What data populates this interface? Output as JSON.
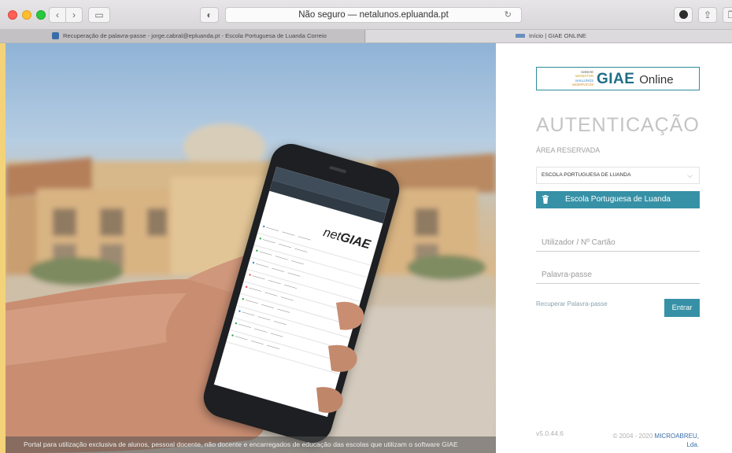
{
  "browser": {
    "address": "Não seguro — netalunos.epluanda.pt",
    "tabs": [
      {
        "label": "Recuperação de palavra-passe - jorge.cabral@epluanda.pt - Escola Portuguesa de Luanda Correio"
      },
      {
        "label": "Início | GIAE ONLINE"
      }
    ]
  },
  "hero": {
    "caption": "Portal para utilização exclusiva de alunos, pessoal docente, não docente e encarregados de educação das escolas que utilizam o software GIAE"
  },
  "phone": {
    "logo_prefix": "net",
    "logo_main": "GIAE"
  },
  "login": {
    "logo": {
      "stack": [
        "netGIAE",
        "netGESTOR",
        "netALUNOS",
        "netSERVICOS"
      ],
      "brand": "GIAE",
      "suffix": "Online"
    },
    "title": "AUTENTICAÇÃO",
    "area_label": "ÁREA RESERVADA",
    "school_select_value": "ESCOLA PORTUGUESA DE LUANDA",
    "school_button_label": "Escola Portuguesa de Luanda",
    "username_placeholder": "Utilizador / Nº Cartão",
    "password_placeholder": "Palavra-passe",
    "recover_label": "Recuperar Palavra-passe",
    "login_label": "Entrar"
  },
  "footer": {
    "version": "v5.0.44.6",
    "copyright_prefix": "© 2004 - 2020",
    "company": "MICROABREU,",
    "company_suffix": "Lda."
  },
  "colors": {
    "accent": "#3791a6",
    "logo_border": "#2e8b9b",
    "logo_text": "#1f6e86"
  }
}
